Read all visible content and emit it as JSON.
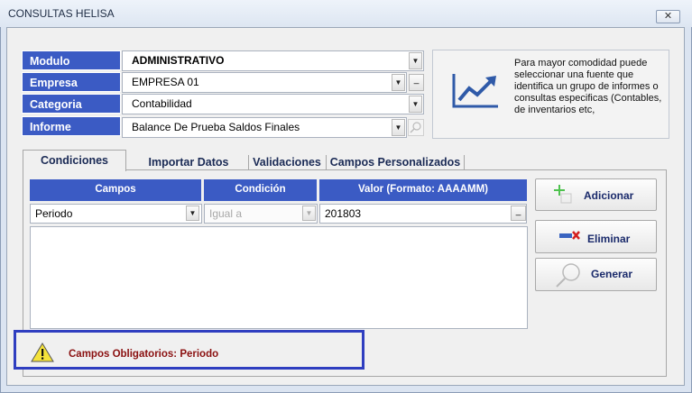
{
  "window": {
    "title": "CONSULTAS HELISA",
    "close_label": "✕"
  },
  "form": {
    "modulo_label": "Modulo",
    "modulo_value": "ADMINISTRATIVO",
    "empresa_label": "Empresa",
    "empresa_value": "EMPRESA 01",
    "categoria_label": "Categoria",
    "categoria_value": "Contabilidad",
    "informe_label": "Informe",
    "informe_value": "Balance De Prueba Saldos Finales",
    "browse_label": "_"
  },
  "info": {
    "text": "Para mayor comodidad puede seleccionar una fuente que identifica un grupo de informes o consultas especificas (Contables, de inventarios etc,"
  },
  "tabs": [
    "Condiciones",
    "Importar Datos",
    "Validaciones",
    "Campos Personalizados"
  ],
  "conditions": {
    "headers": [
      "Campos",
      "Condición",
      "Valor (Formato: AAAAMM)"
    ],
    "campo": "Periodo",
    "condicion": "Igual a",
    "valor": "201803"
  },
  "actions": {
    "add_label": "Adicionar",
    "delete_label": "Eliminar",
    "generate_label": "Generar"
  },
  "warning": {
    "text": "Campos Obligatorios: Periodo"
  },
  "colors": {
    "label_bg": "#3b5bc4",
    "warning_border": "#2f3ec0",
    "warning_text": "#8a1010"
  }
}
